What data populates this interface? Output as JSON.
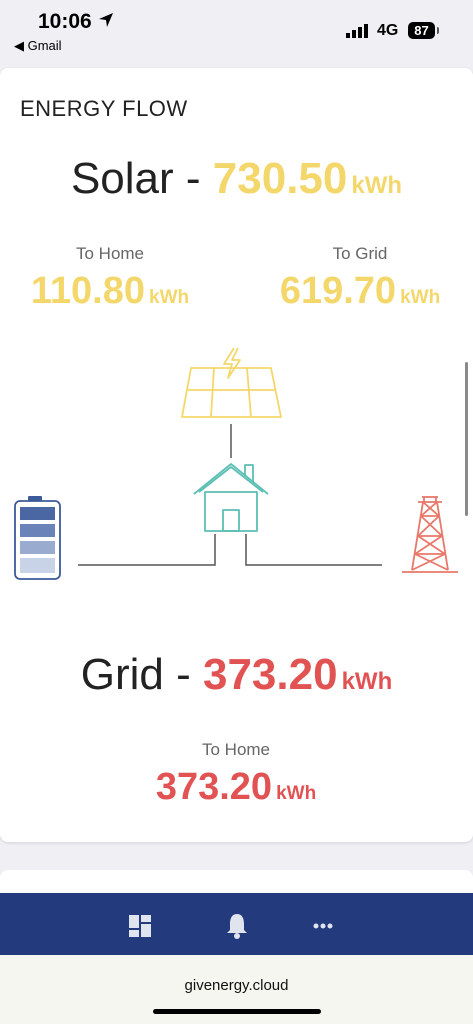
{
  "status_bar": {
    "time": "10:06",
    "back_app": "◀ Gmail",
    "network": "4G",
    "battery": "87"
  },
  "card": {
    "title": "ENERGY FLOW",
    "solar": {
      "label": "Solar - ",
      "value": "730.50",
      "unit": "kWh",
      "to_home_label": "To Home",
      "to_home_value": "110.80",
      "to_home_unit": "kWh",
      "to_grid_label": "To Grid",
      "to_grid_value": "619.70",
      "to_grid_unit": "kWh"
    },
    "grid": {
      "label": "Grid - ",
      "value": "373.20",
      "unit": "kWh",
      "to_home_label": "To Home",
      "to_home_value": "373.20",
      "to_home_unit": "kWh"
    }
  },
  "colors": {
    "solar": "#f4d76b",
    "grid": "#e15353",
    "home": "#5cbfb4",
    "battery": "#3d5a99",
    "nav_bg": "#233b7c"
  },
  "icons": {
    "solar_panel": "solar-panel-icon",
    "home": "house-icon",
    "battery": "battery-icon",
    "grid": "pylon-icon",
    "nav": [
      "dashboard-icon",
      "bell-icon",
      "more-icon"
    ]
  },
  "browser": {
    "url": "givenergy.cloud"
  }
}
